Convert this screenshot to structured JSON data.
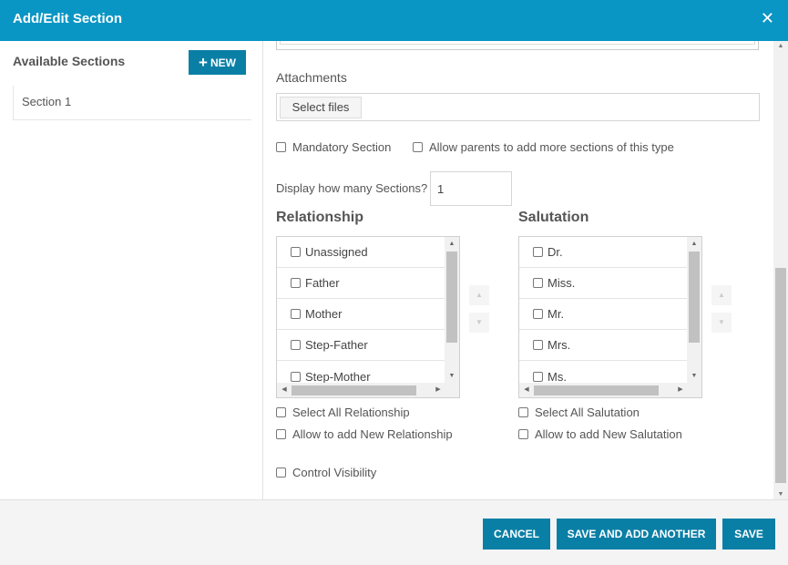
{
  "header": {
    "title": "Add/Edit Section",
    "close_glyph": "✕"
  },
  "sidebar": {
    "title": "Available Sections",
    "new_button": {
      "icon": "plus-icon",
      "label": "NEW"
    },
    "items": [
      {
        "label": "Section 1"
      }
    ]
  },
  "form": {
    "attachments_label": "Attachments",
    "select_files_label": "Select files",
    "mandatory_label": "Mandatory Section",
    "allow_parents_label": "Allow parents to add more sections of this type",
    "display_count_label": "Display how many Sections?",
    "display_count_value": "1",
    "relationship": {
      "title": "Relationship",
      "items": [
        "Unassigned",
        "Father",
        "Mother",
        "Step-Father",
        "Step-Mother"
      ],
      "select_all_label": "Select All Relationship",
      "allow_new_label": "Allow to add New Relationship"
    },
    "salutation": {
      "title": "Salutation",
      "items": [
        "Dr.",
        "Miss.",
        "Mr.",
        "Mrs.",
        "Ms."
      ],
      "select_all_label": "Select All Salutation",
      "allow_new_label": "Allow to add New Salutation"
    },
    "control_visibility_label": "Control Visibility"
  },
  "footer": {
    "cancel_label": "CANCEL",
    "save_add_label": "SAVE AND ADD ANOTHER",
    "save_label": "SAVE"
  },
  "colors": {
    "header_bg": "#0a96c4",
    "button_bg": "#0a7fa6"
  }
}
